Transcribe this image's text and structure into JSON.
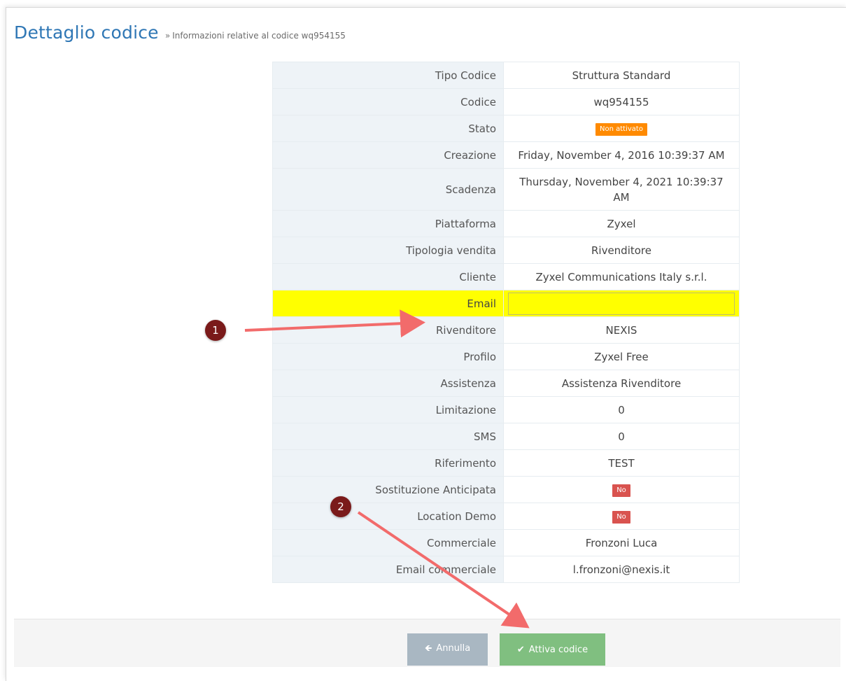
{
  "header": {
    "title": "Dettaglio codice",
    "separator": "»",
    "subtitle": "Informazioni relative al codice wq954155"
  },
  "details": {
    "rows": [
      {
        "label": "Tipo Codice",
        "value": "Struttura Standard"
      },
      {
        "label": "Codice",
        "value": "wq954155"
      },
      {
        "label": "Stato",
        "value": "Non attivato",
        "badge": "orange"
      },
      {
        "label": "Creazione",
        "value": "Friday, November 4, 2016 10:39:37 AM"
      },
      {
        "label": "Scadenza",
        "value": "Thursday, November 4, 2021 10:39:37 AM"
      },
      {
        "label": "Piattaforma",
        "value": "Zyxel"
      },
      {
        "label": "Tipologia vendita",
        "value": "Rivenditore"
      },
      {
        "label": "Cliente",
        "value": "Zyxel Communications Italy s.r.l."
      },
      {
        "label": "Email",
        "value": "",
        "input": true
      },
      {
        "label": "Rivenditore",
        "value": "NEXIS"
      },
      {
        "label": "Profilo",
        "value": "Zyxel Free"
      },
      {
        "label": "Assistenza",
        "value": "Assistenza Rivenditore"
      },
      {
        "label": "Limitazione",
        "value": "0"
      },
      {
        "label": "SMS",
        "value": "0"
      },
      {
        "label": "Riferimento",
        "value": "TEST"
      },
      {
        "label": "Sostituzione Anticipata",
        "value": "No",
        "badge": "red"
      },
      {
        "label": "Location Demo",
        "value": "No",
        "badge": "red"
      },
      {
        "label": "Commerciale",
        "value": "Fronzoni Luca"
      },
      {
        "label": "Email commerciale",
        "value": "l.fronzoni@nexis.it"
      }
    ]
  },
  "buttons": {
    "cancel_label": "Annulla",
    "submit_label": "Attiva codice"
  },
  "annotations": {
    "step1": "1",
    "step2": "2",
    "colors": {
      "highlight": "#ffff00",
      "arrow": "#f26b6b",
      "circle": "#7a1a1a"
    }
  },
  "colors": {
    "title": "#2f77b5",
    "badge_orange": "#ff8a00",
    "badge_red": "#d9534f",
    "cancel_button": "#a9b7c2",
    "submit_button": "#80bf80"
  },
  "icons": {
    "cancel": "arrow-left-icon",
    "submit": "checkmark-icon"
  }
}
